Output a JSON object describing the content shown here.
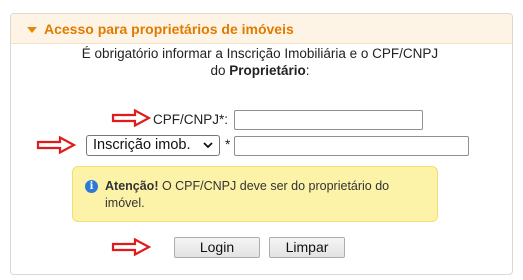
{
  "panel": {
    "title": "Acesso para proprietários de imóveis"
  },
  "instruction": {
    "line1": "É obrigatório informar a Inscrição Imobiliária e o CPF/CNPJ",
    "line2_prefix": "do ",
    "line2_bold": "Proprietário",
    "line2_suffix": ":"
  },
  "form": {
    "cpf_label": "CPF/CNPJ*:",
    "cpf_value": "",
    "inscricao_select_value": "Inscrição imob.",
    "inscricao_asterisk": "*",
    "inscricao_value": ""
  },
  "alert": {
    "strong": "Atenção!",
    "text": " O CPF/CNPJ deve ser do proprietário do imóvel.",
    "icon": "info-icon"
  },
  "buttons": {
    "login": "Login",
    "clear": "Limpar"
  },
  "colors": {
    "header_bg": "#fef4e6",
    "header_text": "#e07b00",
    "alert_bg": "#fcf3a8",
    "arrow_red": "#e01b1b",
    "info_blue": "#2c7ad6"
  }
}
